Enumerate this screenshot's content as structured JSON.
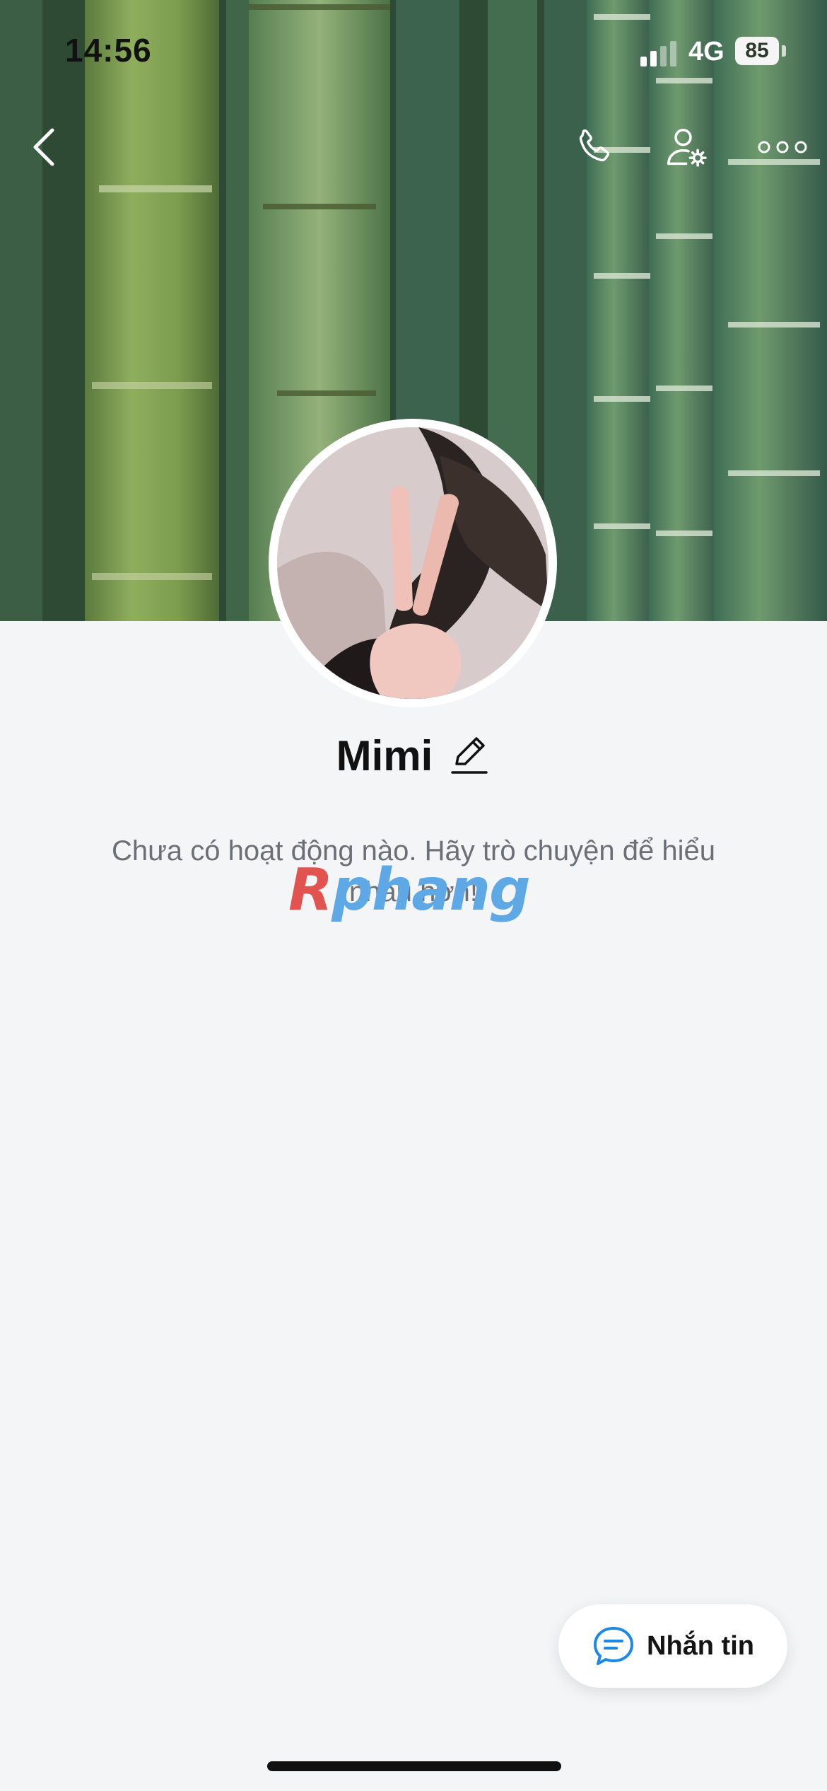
{
  "status_bar": {
    "time": "14:56",
    "network": "4G",
    "battery": "85"
  },
  "nav": {
    "back_icon": "chevron-left-icon",
    "call_icon": "phone-icon",
    "settings_icon": "user-settings-icon",
    "more_icon": "more-horizontal-icon"
  },
  "profile": {
    "name": "Mimi",
    "edit_icon": "pencil-icon"
  },
  "activity": {
    "empty_message": "Chưa có hoạt động nào. Hãy trò chuyện để hiểu nhau hơn!"
  },
  "watermark": {
    "first_letter": "R",
    "rest": "phang"
  },
  "actions": {
    "message_label": "Nhắn tin",
    "message_icon": "chat-bubble-icon"
  },
  "colors": {
    "accent": "#1e88e5",
    "background": "#f4f5f7",
    "text": "#111111",
    "muted": "#6b6f76"
  }
}
